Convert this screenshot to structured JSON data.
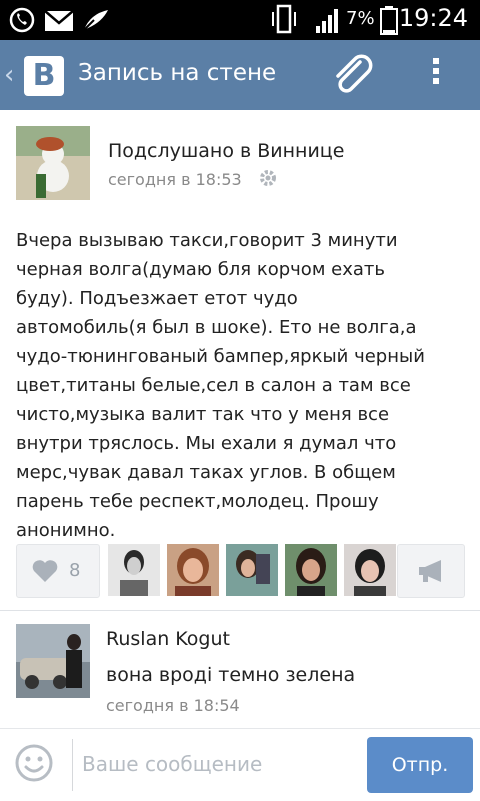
{
  "status_bar": {
    "battery": "7%",
    "time": "19:24"
  },
  "header": {
    "title": "Запись на стене",
    "logo_letter": "B"
  },
  "post": {
    "author": "Подслушано в Виннице",
    "time": "сегодня в 18:53",
    "text": "Вчера вызываю такси,говорит 3 минути\nчерная волга(думаю бля корчом ехать\nбуду). Подъезжает етот чудо\nавтомобиль(я был в шоке). Ето не волга,а\nчудо-тюнингованый бампер,яркый черный\nцвет,титаны белые,сел в салон а там все\nчисто,музыка валит так что у меня все\nвнутри тряслось. Мы ехали я думал что\nмерс,чувак давал таках углов. В общем\nпарень тебе респект,молодец. Прошу\nанонимно.",
    "likes": "8"
  },
  "comment": {
    "author": "Ruslan Kogut",
    "text": "вона вроді темно зелена",
    "time": "сегодня в 18:54"
  },
  "composer": {
    "placeholder": "Ваше сообщение",
    "send_label": "Отпр."
  },
  "colors": {
    "header": "#5b7fa6",
    "send": "#5b8cc9"
  }
}
